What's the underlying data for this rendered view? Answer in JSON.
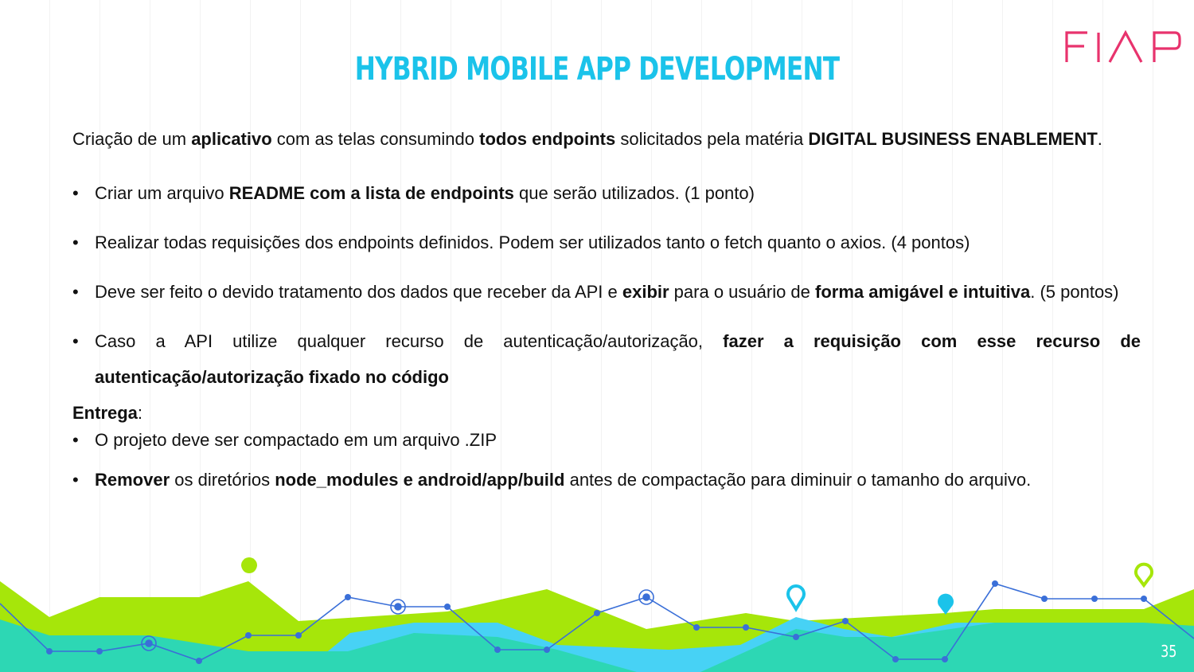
{
  "logo": {
    "text": "FIAP",
    "color": "#e8336d"
  },
  "title": "HYBRID MOBILE APP DEVELOPMENT",
  "accent_color": "#1bc3ea",
  "intro": {
    "t1": "Criação de um ",
    "b1": "aplicativo",
    "t2": " com as telas consumindo ",
    "b2": "todos endpoints",
    "t3": " solicitados pela matéria ",
    "b3": "DIGITAL BUSINESS ENABLEMENT",
    "t4": "."
  },
  "bullets": [
    {
      "t1": "Criar um arquivo ",
      "b1": "README com a lista de endpoints",
      "t2": " que serão utilizados. (1 ponto)"
    },
    {
      "t1": "Realizar todas requisições dos endpoints definidos. Podem ser utilizados tanto o fetch quanto o axios. (4 pontos)"
    },
    {
      "t1": "Deve ser feito o devido tratamento dos dados que receber da API e ",
      "b1": "exibir",
      "t2": " para o usuário de ",
      "b2": "forma amigável e intuitiva",
      "t3": ". (5 pontos)"
    },
    {
      "t1": "Caso a API utilize qualquer recurso de autenticação/autorização, ",
      "b1": "fazer a requisição com esse recurso de autenticação/autorização fixado no código"
    }
  ],
  "delivery": {
    "label": "Entrega",
    "colon": ":",
    "items": [
      {
        "t1": "O projeto deve ser compactado em um arquivo .ZIP"
      },
      {
        "b1": "Remover",
        "t1": " os diretórios ",
        "b2": "node_modules e android/app/build",
        "t2": " antes de compactação para diminuir o tamanho do arquivo."
      }
    ]
  },
  "footer_colors": {
    "green": "#a6e60a",
    "teal": "#2dd7b4",
    "sky": "#47d2f5",
    "line": "#3a6fd8"
  },
  "page_number": "35"
}
